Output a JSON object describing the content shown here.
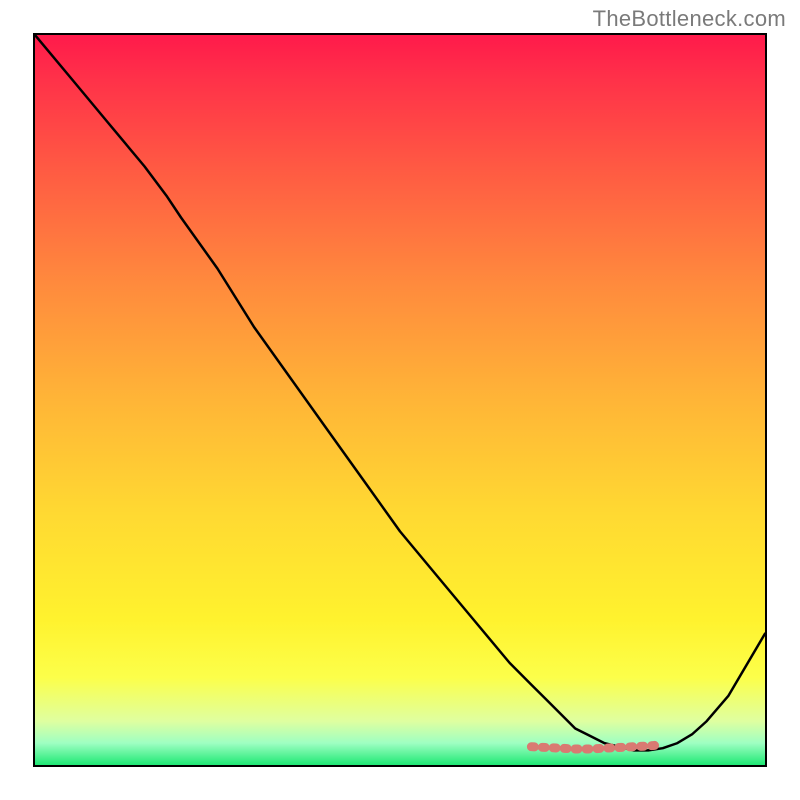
{
  "watermark": "TheBottleneck.com",
  "chart_data": {
    "type": "line",
    "title": "",
    "xlabel": "",
    "ylabel": "",
    "xlim": [
      0,
      100
    ],
    "ylim": [
      0,
      100
    ],
    "grid": false,
    "legend": false,
    "series": [
      {
        "name": "curve",
        "color": "#000000",
        "x": [
          0,
          5,
          10,
          15,
          18,
          20,
          25,
          30,
          35,
          40,
          45,
          50,
          55,
          60,
          65,
          68,
          70,
          72,
          74,
          76,
          78,
          80,
          82,
          84,
          86,
          88,
          90,
          92,
          95,
          100
        ],
        "values": [
          100,
          94,
          88,
          82,
          78,
          75,
          68,
          60,
          53,
          46,
          39,
          32,
          26,
          20,
          14,
          11,
          9,
          7,
          5,
          4,
          3,
          2.5,
          2,
          2,
          2.3,
          3.0,
          4.2,
          6.0,
          9.5,
          18
        ]
      },
      {
        "name": "marker-band",
        "color": "#d97a72",
        "x": [
          68,
          70,
          72,
          74,
          76,
          78,
          80,
          82,
          84,
          85
        ],
        "values": [
          2.5,
          2.4,
          2.3,
          2.2,
          2.2,
          2.3,
          2.4,
          2.5,
          2.6,
          2.7
        ]
      }
    ],
    "annotations": []
  }
}
